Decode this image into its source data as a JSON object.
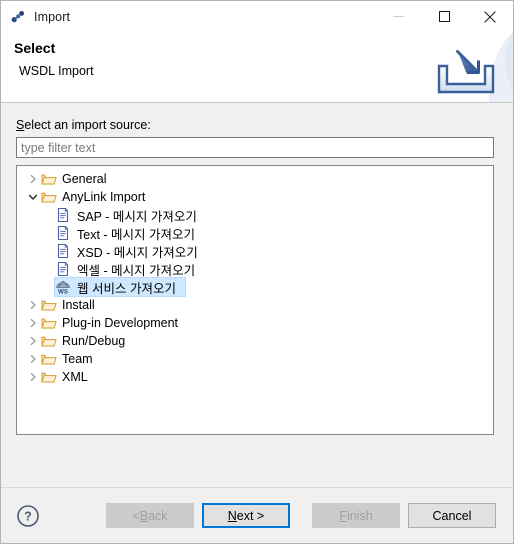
{
  "window": {
    "title": "Import",
    "title_icon": "import-link-icon",
    "controls": {
      "minimize": "minimize-icon",
      "maximize": "maximize-icon",
      "close": "close-icon"
    }
  },
  "header": {
    "title": "Select",
    "subtitle": "WSDL Import",
    "graphic": "import-tray-arrow-icon"
  },
  "main": {
    "source_label_prefix": "S",
    "source_label_rest": "elect an import source:",
    "filter": {
      "value": "",
      "placeholder": "type filter text"
    },
    "tree": [
      {
        "label": "General",
        "level": 0,
        "icon": "folder-icon",
        "state": "collapsed",
        "selected": false
      },
      {
        "label": "AnyLink Import",
        "level": 0,
        "icon": "folder-icon",
        "state": "expanded",
        "selected": false
      },
      {
        "label": "SAP - 메시지 가져오기",
        "level": 1,
        "icon": "document-icon",
        "state": "leaf",
        "selected": false
      },
      {
        "label": "Text - 메시지 가져오기",
        "level": 1,
        "icon": "document-icon",
        "state": "leaf",
        "selected": false
      },
      {
        "label": "XSD - 메시지 가져오기",
        "level": 1,
        "icon": "document-icon",
        "state": "leaf",
        "selected": false
      },
      {
        "label": "엑셀 - 메시지 가져오기",
        "level": 1,
        "icon": "document-icon",
        "state": "leaf",
        "selected": false
      },
      {
        "label": "웹 서비스 가져오기",
        "level": 1,
        "icon": "webservice-ws-icon",
        "state": "leaf",
        "selected": true
      },
      {
        "label": "Install",
        "level": 0,
        "icon": "folder-icon",
        "state": "collapsed",
        "selected": false
      },
      {
        "label": "Plug-in Development",
        "level": 0,
        "icon": "folder-icon",
        "state": "collapsed",
        "selected": false
      },
      {
        "label": "Run/Debug",
        "level": 0,
        "icon": "folder-icon",
        "state": "collapsed",
        "selected": false
      },
      {
        "label": "Team",
        "level": 0,
        "icon": "folder-icon",
        "state": "collapsed",
        "selected": false
      },
      {
        "label": "XML",
        "level": 0,
        "icon": "folder-icon",
        "state": "collapsed",
        "selected": false
      }
    ]
  },
  "buttons": {
    "help": "?",
    "back": {
      "pre": "< ",
      "mnemonic": "B",
      "post": "ack",
      "state": "disabled"
    },
    "next": {
      "pre": "",
      "mnemonic": "N",
      "post": "ext >",
      "state": "default"
    },
    "finish": {
      "pre": "",
      "mnemonic": "F",
      "post": "inish",
      "state": "disabled"
    },
    "cancel": {
      "pre": "",
      "mnemonic": "",
      "post": "Cancel",
      "state": "enabled"
    }
  },
  "colors": {
    "accent": "#0078d7",
    "selection": "#cde8ff",
    "folder": "#e8a33d",
    "dialog_bg": "#f0f0f0"
  }
}
